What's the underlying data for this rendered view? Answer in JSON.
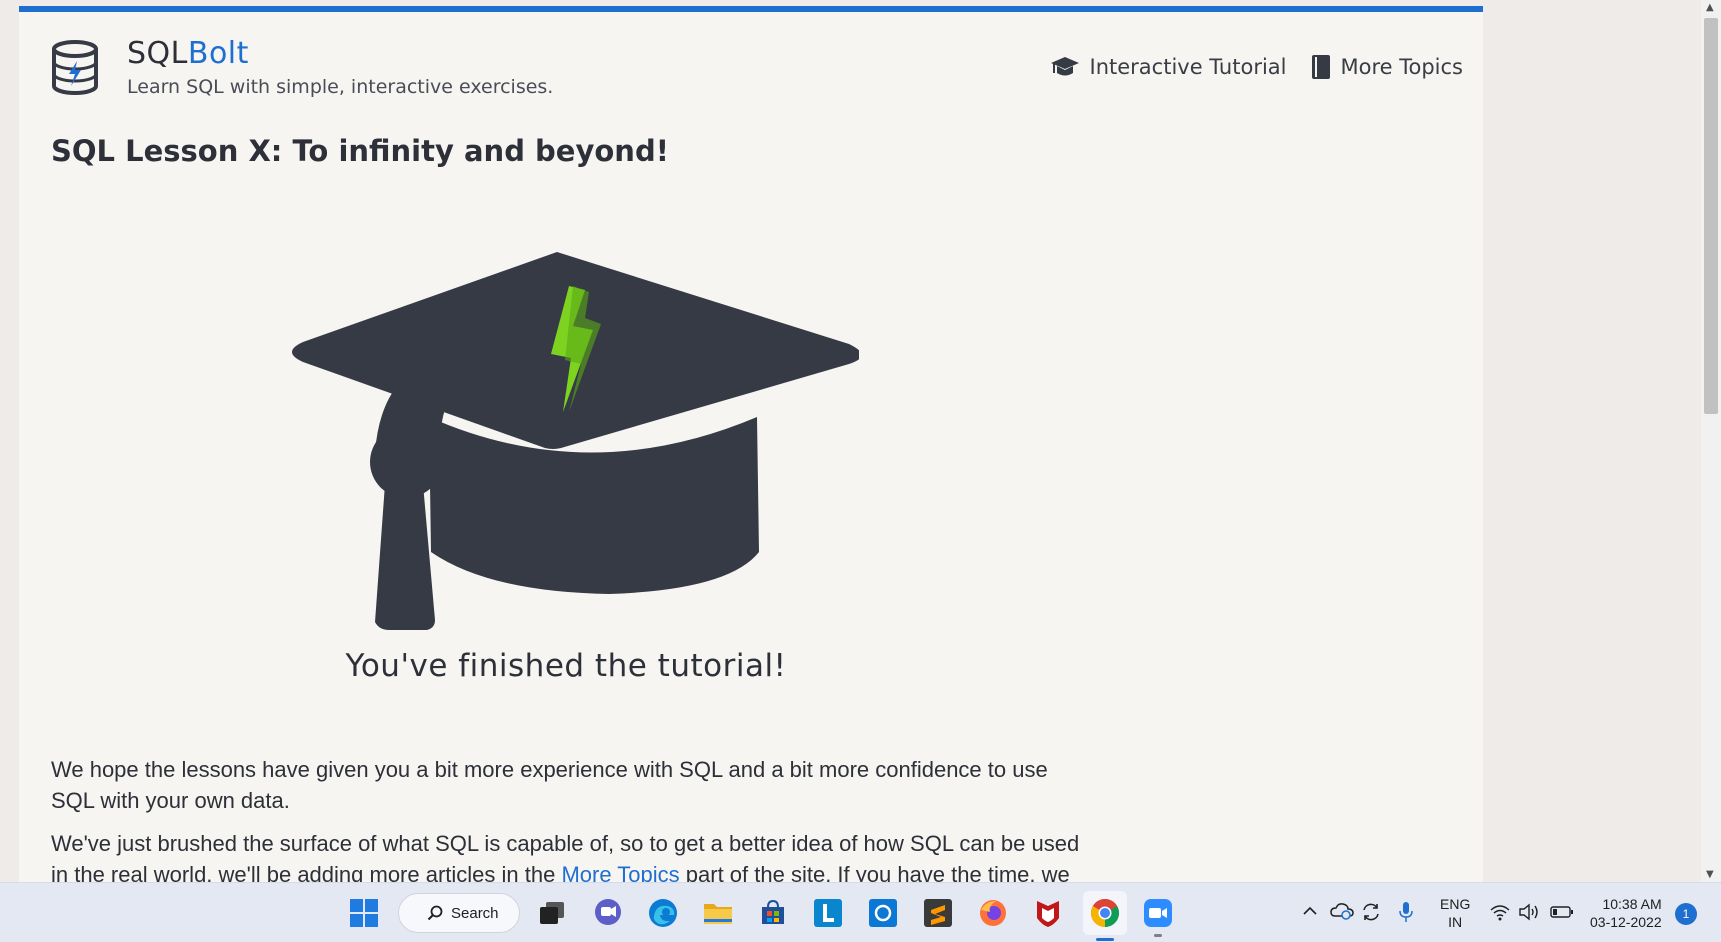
{
  "site": {
    "brand_main": "SQL",
    "brand_accent": "Bolt",
    "tagline": "Learn SQL with simple, interactive exercises."
  },
  "nav": {
    "tutorial_label": "Interactive Tutorial",
    "topics_label": "More Topics"
  },
  "lesson": {
    "title": "SQL Lesson X: To infinity and beyond!",
    "finished_text": "You've finished the tutorial!",
    "paragraph1": "We hope the lessons have given you a bit more experience with SQL and a bit more confidence to use SQL with your own data.",
    "paragraph2_before": "We've just brushed the surface of what SQL is capable of, so to get a better idea of how SQL can be used in the real world, we'll be adding more articles in the ",
    "paragraph2_link": "More Topics",
    "paragraph2_after": " part of the site. If you have the time, we"
  },
  "taskbar": {
    "search_label": "Search",
    "apps": [
      "windows-start",
      "search",
      "task-view",
      "teams-chat",
      "edge",
      "file-explorer",
      "microsoft-store",
      "linkedin-learning",
      "cortana",
      "sublime-text",
      "firefox",
      "mcafee",
      "chrome",
      "zoom"
    ],
    "lang_line1": "ENG",
    "lang_line2": "IN",
    "time": "10:38 AM",
    "date": "03-12-2022",
    "notifications": "1"
  },
  "colors": {
    "accent": "#1f6fd1",
    "cap": "#363a45",
    "bolt": "#7ed321",
    "page_bg": "#f6f5f2"
  }
}
